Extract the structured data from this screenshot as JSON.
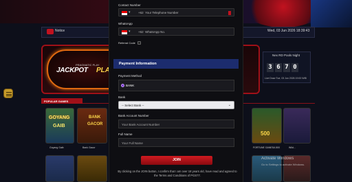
{
  "header": {
    "notice_label": "Notice",
    "datetime": "Wed, 03 Jun 2026 18:39:43"
  },
  "jackpot": {
    "small_text": "PRAGMATIC PLAY",
    "title_a": "JACKPOT",
    "title_b": "PLAY"
  },
  "pools": {
    "title": "Nex RD Pools Night",
    "digits": [
      "3",
      "6",
      "7",
      "0"
    ],
    "live_text": "Live Draw Tue, 03 Jun 2026 19:00 WIB"
  },
  "popular": {
    "tab_label": "POPULAR GAMES"
  },
  "games": {
    "g1_title_a": "GOYANG",
    "g1_title_b": "GAIB",
    "g1_label": "Goyang Gaib",
    "g2_title_a": "BANK",
    "g2_title_b": "GACOR",
    "g2_label": "Bank Gacor",
    "r1_title": "500",
    "r1_label": "FORTUNE GANESA 500",
    "r2_label": "Wild..."
  },
  "windows": {
    "activate_title": "Activate Windows",
    "activate_sub": "Go to Settings to activate Windows."
  },
  "form": {
    "contact_label": "Contact Number",
    "phone_code": "+62",
    "phone_placeholder": "Your Telephone Number",
    "whatsapp_label": "WhatsApp",
    "wa_code": "+62",
    "wa_placeholder": "WhatsApp No.",
    "referral_label": "Referral Code",
    "payment_section": "Payment Information",
    "payment_method_label": "Payment Method",
    "payment_method_value": "BANK",
    "bank_label": "Bank",
    "bank_select": "-- Select Bank --",
    "account_number_label": "Bank Account Number",
    "account_number_placeholder": "Your Bank Account Number",
    "full_name_label": "Full Name",
    "full_name_placeholder": "Your Full Name",
    "join_button": "JOIN",
    "terms_line1": "By clicking on the JOIN button, I confirm that I am over 18 years old, have read and agreed to",
    "terms_line2": "the Terms and Conditions of PGS77."
  }
}
